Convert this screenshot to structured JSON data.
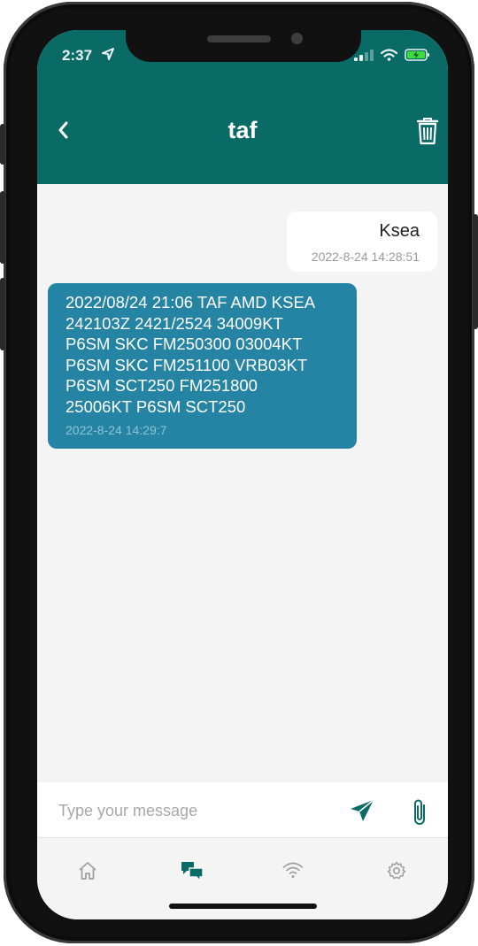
{
  "status_bar": {
    "time": "2:37",
    "icons": [
      "location-arrow-icon",
      "signal-icon",
      "wifi-icon",
      "battery-charging-icon"
    ]
  },
  "header": {
    "title": "taf",
    "back_icon": "chevron-left-icon",
    "delete_icon": "trash-icon"
  },
  "messages": [
    {
      "direction": "outgoing",
      "text": "Ksea",
      "timestamp": "2022-8-24 14:28:51"
    },
    {
      "direction": "incoming",
      "text": "2022/08/24 21:06 TAF AMD KSEA\n242103Z 2421/2524 34009KT\nP6SM SKC FM250300 03004KT\nP6SM SKC FM251100 VRB03KT\nP6SM SCT250 FM251800\n25006KT P6SM SCT250",
      "timestamp": "2022-8-24 14:29:7"
    }
  ],
  "composer": {
    "placeholder": "Type your message",
    "value": "",
    "send_icon": "send-icon",
    "attach_icon": "paperclip-icon"
  },
  "tabs": [
    {
      "name": "home",
      "icon": "home-icon",
      "active": false
    },
    {
      "name": "messages",
      "icon": "chat-bubbles-icon",
      "active": true
    },
    {
      "name": "connection",
      "icon": "wifi-icon",
      "active": false
    },
    {
      "name": "settings",
      "icon": "gear-icon",
      "active": false
    }
  ],
  "colors": {
    "header": "#0a6b66",
    "incoming_bubble": "#2584a4",
    "accent": "#0a6b66",
    "inactive_icon": "#a0a0a0"
  }
}
